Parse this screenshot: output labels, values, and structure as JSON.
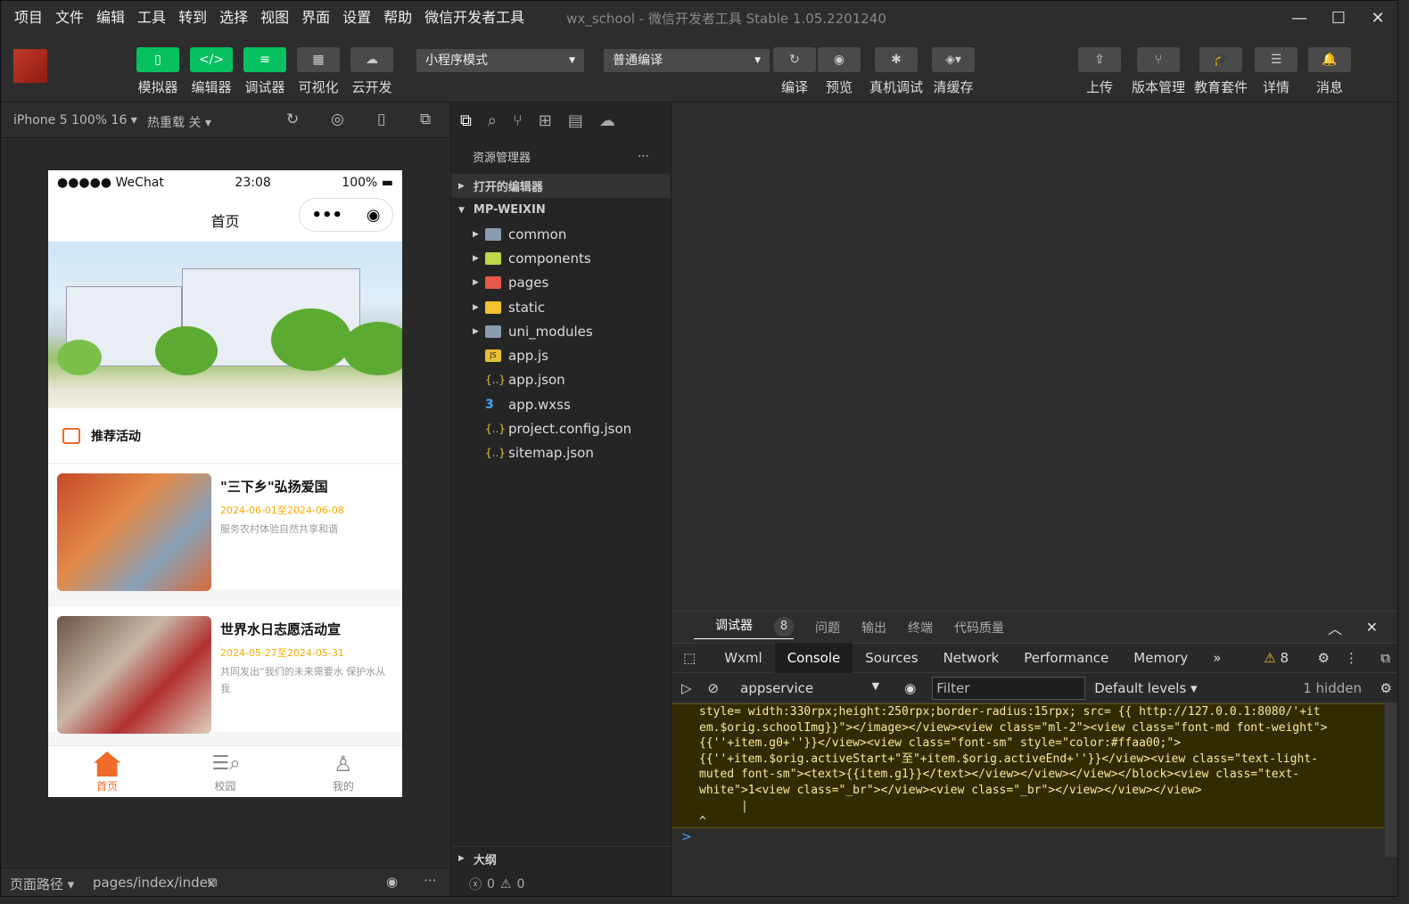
{
  "menu": [
    "项目",
    "文件",
    "编辑",
    "工具",
    "转到",
    "选择",
    "视图",
    "界面",
    "设置",
    "帮助",
    "微信开发者工具"
  ],
  "window_title": "wx_school - 微信开发者工具 Stable 1.05.2201240",
  "toolbar": {
    "simulator": "模拟器",
    "editor": "编辑器",
    "debugger": "调试器",
    "visual": "可视化",
    "cloud": "云开发",
    "mode_select": "小程序模式",
    "compile_select": "普通编译",
    "compile": "编译",
    "preview": "预览",
    "real_debug": "真机调试",
    "clear_cache": "清缓存",
    "upload": "上传",
    "version": "版本管理",
    "edu": "教育套件",
    "detail": "详情",
    "message": "消息"
  },
  "sim_header": {
    "device": "iPhone 5 100% 16 ▾",
    "hot_reload": "热重载 关 ▾"
  },
  "phone": {
    "carrier": "●●●●● WeChat",
    "time": "23:08",
    "battery": "100%",
    "title": "首页",
    "section_title": "推荐活动",
    "cards": [
      {
        "title": "\"三下乡\"弘扬爱国",
        "date": "2024-06-01至2024-06-08",
        "desc": "服务农村体验自然共享和谐"
      },
      {
        "title": "世界水日志愿活动宣",
        "date": "2024-05-27至2024-05-31",
        "desc": "共同发出“我们的未来需要水 保护水从我"
      }
    ],
    "tabs": [
      "首页",
      "校园",
      "我的"
    ],
    "accent": "#f06a28"
  },
  "sim_footer": {
    "path_label": "页面路径 ▾",
    "path": "pages/index/index"
  },
  "explorer": {
    "title": "资源管理器",
    "open_editors": "打开的编辑器",
    "project": "MP-WEIXIN",
    "items": [
      {
        "name": "common",
        "type": "folder"
      },
      {
        "name": "components",
        "type": "folder"
      },
      {
        "name": "pages",
        "type": "folder"
      },
      {
        "name": "static",
        "type": "folder"
      },
      {
        "name": "uni_modules",
        "type": "folder"
      },
      {
        "name": "app.js",
        "type": "file"
      },
      {
        "name": "app.json",
        "type": "file"
      },
      {
        "name": "app.wxss",
        "type": "file"
      },
      {
        "name": "project.config.json",
        "type": "file"
      },
      {
        "name": "sitemap.json",
        "type": "file"
      }
    ],
    "outline": "大纲",
    "errors": "0",
    "warnings": "0"
  },
  "devtools": {
    "panel_tabs": [
      "调试器",
      "问题",
      "输出",
      "终端",
      "代码质量"
    ],
    "debugger_badge": "8",
    "tabs": [
      "Wxml",
      "Console",
      "Sources",
      "Network",
      "Performance",
      "Memory"
    ],
    "warnings_count": "8",
    "context": "appservice",
    "filter_placeholder": "Filter",
    "levels": "Default levels ▾",
    "hidden": "1 hidden",
    "console_lines": [
      "style= width:330rpx;height:250rpx;border-radius:15rpx;  src= {{ http://127.0.0.1:8080/'+it",
      "em.$orig.schoolImg}}\"></image></view><view class=\"ml-2\"><view class=\"font-md font-weight\">",
      "{{''+item.g0+''}}</view><view class=\"font-sm\" style=\"color:#ffaa00;\">",
      "{{''+item.$orig.activeStart+\"至\"+item.$orig.activeEnd+''}}</view><view class=\"text-light-",
      "muted font-sm\"><text>{{item.g1}}</text></view></view></view></block><view class=\"text-",
      "white\">1<view class=\"_br\"></view><view class=\"_br\"></view></view></view>",
      "      |",
      "^"
    ],
    "prompt": ">"
  }
}
